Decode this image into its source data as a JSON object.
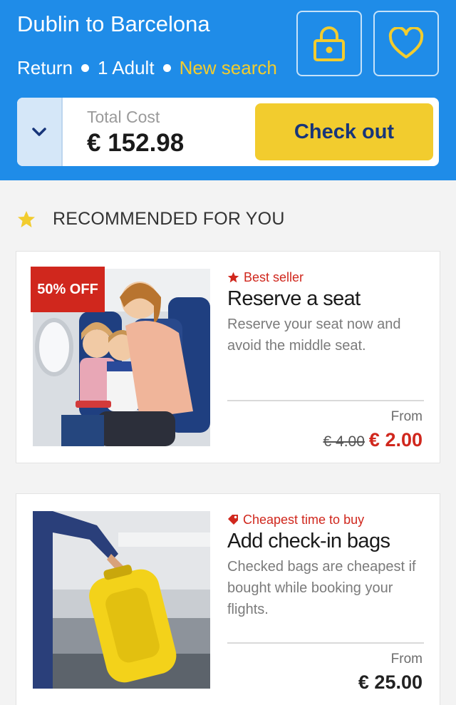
{
  "header": {
    "route": "Dublin to Barcelona",
    "trip_type": "Return",
    "passengers": "1 Adult",
    "new_search": "New search",
    "lock_icon": "lock-icon",
    "favorite_icon": "heart-icon"
  },
  "cost_bar": {
    "total_label": "Total Cost",
    "total_value": "€ 152.98",
    "checkout_label": "Check out",
    "expand_icon": "chevron-down-icon"
  },
  "section": {
    "title": "RECOMMENDED FOR YOU",
    "icon": "star-icon"
  },
  "cards": [
    {
      "badge": "50% OFF",
      "tag": "Best seller",
      "tag_icon": "star-icon",
      "title": "Reserve a seat",
      "description": "Reserve your seat now and avoid the middle seat.",
      "from_label": "From",
      "old_price": "€ 4.00",
      "price": "€ 2.00"
    },
    {
      "tag": "Cheapest time to buy",
      "tag_icon": "price-tag-icon",
      "title": "Add check-in bags",
      "description": "Checked bags are cheapest if bought while booking your flights.",
      "from_label": "From",
      "price": "€ 25.00"
    }
  ],
  "colors": {
    "header_blue": "#1f8ce8",
    "accent_yellow": "#f2cc2e",
    "checkout_text": "#17357a",
    "sale_red": "#d0271d"
  }
}
